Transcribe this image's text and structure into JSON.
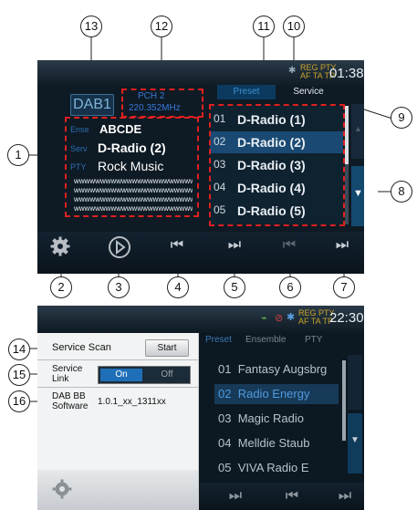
{
  "callouts": [
    "13",
    "12",
    "11",
    "10",
    "9",
    "8",
    "1",
    "2",
    "3",
    "4",
    "5",
    "6",
    "7",
    "14",
    "15",
    "16"
  ],
  "screen1": {
    "band": "DAB1",
    "pch": "PCH 2",
    "freq": "220.352MHz",
    "status_reg": "REG PTY",
    "status_af": "AF TA TP",
    "clock": "01:38",
    "tab_preset": "Preset",
    "tab_service": "Service",
    "ensemble_label": "Ense",
    "ensemble_value": "ABCDE",
    "service_label": "Serv",
    "service_value": "D-Radio (2)",
    "pty_label": "PTY",
    "pty_value": "Rock Music",
    "radiotext": [
      "wwwwwwwwwwwwwwwwwwwwwww",
      "wwwwwwwwwwwwwwwwwwwwwww",
      "wwwwwwwwwwwwwwwwwwwwwww",
      "wwwwwwwwwwwwwwwwwwwwwww"
    ],
    "list": [
      {
        "num": "01",
        "name": "D-Radio (1)"
      },
      {
        "num": "02",
        "name": "D-Radio (2)"
      },
      {
        "num": "03",
        "name": "D-Radio (3)"
      },
      {
        "num": "04",
        "name": "D-Radio (4)"
      },
      {
        "num": "05",
        "name": "D-Radio (5)"
      }
    ],
    "selected_index": 1,
    "icons": [
      "settings-icon",
      "play-icon",
      "seek-back-icon",
      "seek-forward-icon",
      "prev-icon",
      "next-icon",
      "scroll-down-icon",
      "scroll-up-icon"
    ]
  },
  "screen2": {
    "status_reg": "REG PTY",
    "status_af": "AF TA TP",
    "clock": "22:30",
    "tab_preset": "Preset",
    "tab_ensemble": "Ensemble",
    "tab_pty": "PTY",
    "service_scan_label": "Service Scan",
    "start_label": "Start",
    "service_link_label_1": "Service",
    "service_link_label_2": "Link",
    "on_label": "On",
    "off_label": "Off",
    "dab_bb_label_1": "DAB BB",
    "dab_bb_label_2": "Software",
    "dab_bb_value": "1.0.1_xx_1311xx",
    "list": [
      {
        "num": "01",
        "name": "Fantasy Augsbrg"
      },
      {
        "num": "02",
        "name": "Radio Energy"
      },
      {
        "num": "03",
        "name": "Magic Radio"
      },
      {
        "num": "04",
        "name": "Melldie Staub"
      },
      {
        "num": "05",
        "name": "VIVA Radio E"
      }
    ],
    "selected_index": 1
  }
}
